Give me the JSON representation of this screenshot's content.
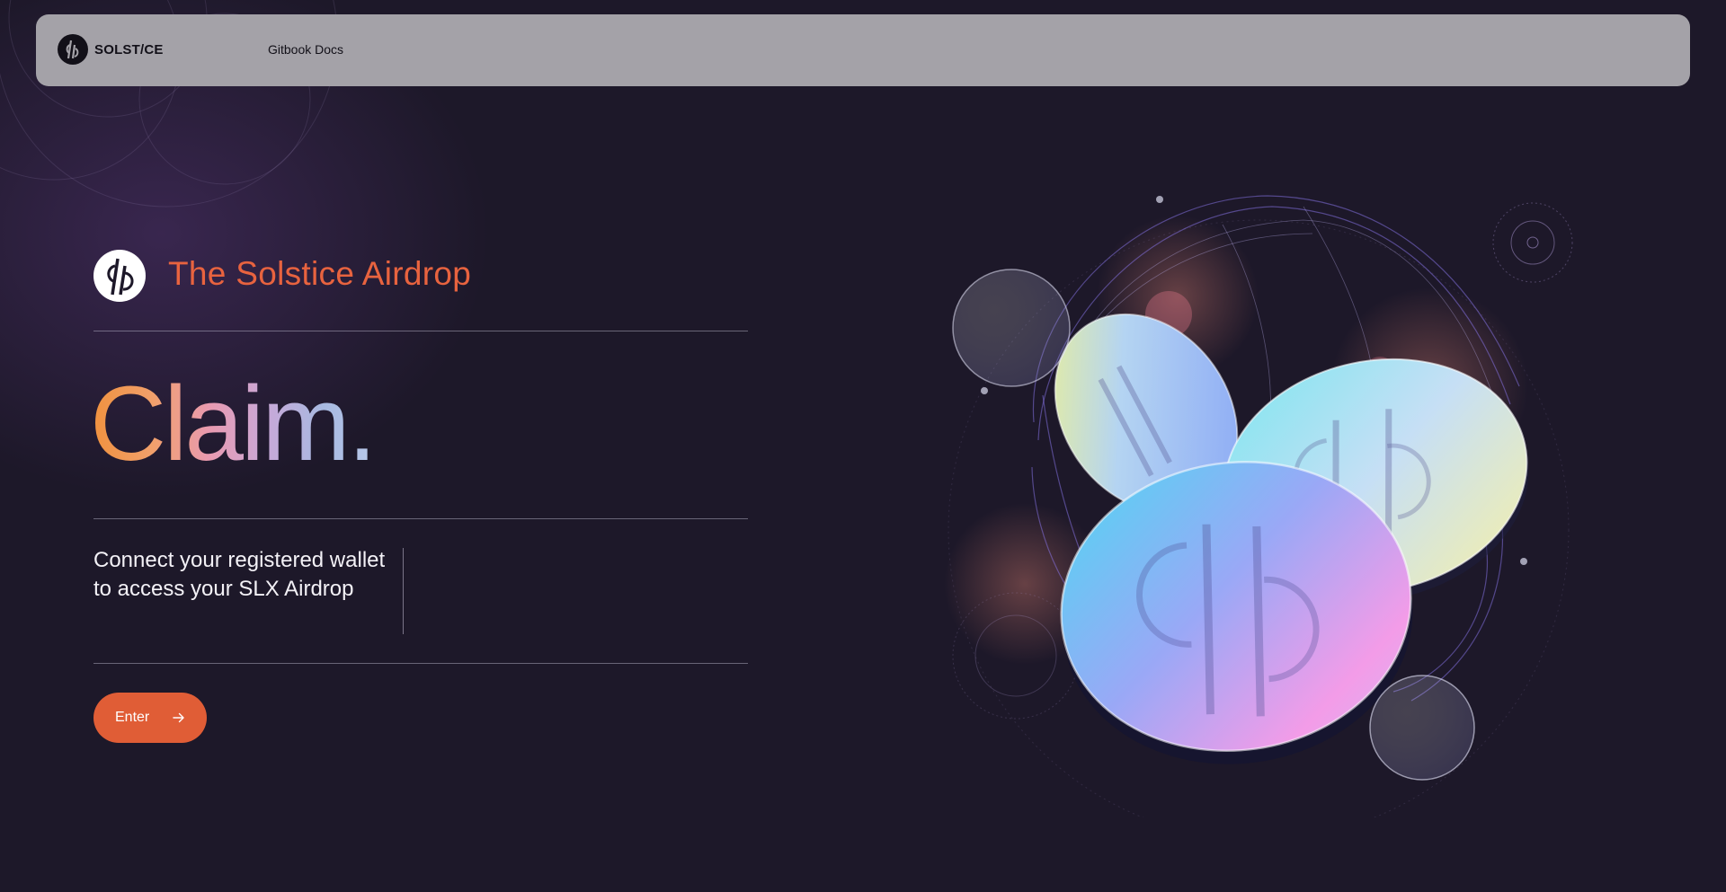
{
  "nav": {
    "brand_name": "SOLST/CE",
    "docs_link": "Gitbook Docs"
  },
  "hero": {
    "subtitle": "The Solstice Airdrop",
    "headline": "Claim.",
    "description": "Connect your registered wallet to access your SLX Airdrop",
    "enter_label": "Enter"
  },
  "icons": {
    "brand": "solstice-logo-icon",
    "hero_logo": "solstice-logo-icon",
    "enter_arrow": "arrow-right-icon"
  },
  "colors": {
    "background": "#1d1829",
    "navbar": "#a4a2a8",
    "accent": "#e05d36",
    "subtitle": "#e8633f"
  }
}
